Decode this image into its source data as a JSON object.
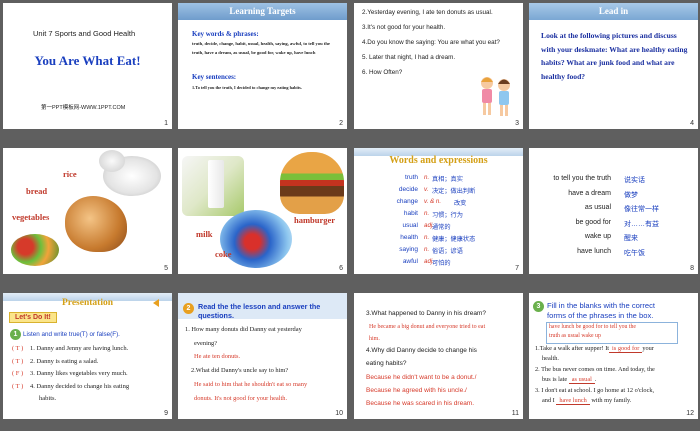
{
  "slides": [
    {
      "num": "1",
      "unit": "Unit 7 Sports and Good Health",
      "title": "You Are What Eat!",
      "footer": "第一PPT模板网-WWW.1PPT.COM"
    },
    {
      "num": "2",
      "header": "Learning Targets",
      "kw_title": "Key words & phrases:",
      "kw_body": "truth, decide, change, habit, usual, health, saying, awful, to tell you the truth, have a dream, as usual, be good for, wake up, have lunch",
      "ks_title": "Key sentences:",
      "ks_body": "1.To tell you the truth, I decided to change my eating habits."
    },
    {
      "num": "3",
      "lines": [
        "2.Yesterday evening, I ate ten donuts as usual.",
        "3.It's not good for your health.",
        "4.Do you know the saying: You are what you eat?",
        "5. Later that night, I had a dream.",
        "6. How Often?"
      ]
    },
    {
      "num": "4",
      "header": "Lead in",
      "body": "Look at the following pictures and discuss with your deskmate: What are healthy eating habits? What are junk food and what are healthy food?"
    },
    {
      "num": "5",
      "labels": {
        "rice": "rice",
        "bread": "bread",
        "vegetables": "vegetables"
      }
    },
    {
      "num": "6",
      "labels": {
        "milk": "milk",
        "coke": "coke",
        "hamburger": "hamburger"
      }
    },
    {
      "num": "7",
      "header": "Words and expressions",
      "words": [
        {
          "en": "truth",
          "pos": "n.",
          "cn": "真相；真实"
        },
        {
          "en": "decide",
          "pos": "v.",
          "cn": "决定；做出判断"
        },
        {
          "en": "change",
          "pos": "v. & n.",
          "cn": "改变"
        },
        {
          "en": "habit",
          "pos": "n.",
          "cn": "习惯；行为"
        },
        {
          "en": "usual",
          "pos": "adj.",
          "cn": "通常的"
        },
        {
          "en": "health",
          "pos": "n.",
          "cn": "健康；健康状态"
        },
        {
          "en": "saying",
          "pos": "n.",
          "cn": "俗语；谚语"
        },
        {
          "en": "awful",
          "pos": "adj.",
          "cn": "可怕的"
        }
      ]
    },
    {
      "num": "8",
      "phrases": [
        {
          "en": "to tell you the truth",
          "cn": "说实话"
        },
        {
          "en": "have a dream",
          "cn": "做梦"
        },
        {
          "en": "as usual",
          "cn": "像往常一样"
        },
        {
          "en": "be good for",
          "cn": "对……有益"
        },
        {
          "en": "wake up",
          "cn": "醒来"
        },
        {
          "en": "have lunch",
          "cn": "吃午饭"
        }
      ]
    },
    {
      "num": "9",
      "header": "Presentation",
      "button": "Let's Do It!",
      "badge": "1",
      "instr": "Listen and write true(T) or false(F).",
      "items": [
        {
          "ans": "( T )",
          "text": "1. Danny and Jenny are having lunch."
        },
        {
          "ans": "( T )",
          "text": "2. Danny is eating a salad."
        },
        {
          "ans": "( F )",
          "text": "3. Danny likes vegetables very much."
        },
        {
          "ans": "( T )",
          "text": "4. Danny decided to change his eating"
        },
        {
          "ans": "",
          "text": "habits."
        }
      ]
    },
    {
      "num": "10",
      "badge": "2",
      "title1": "Read the  the lesson and answer the",
      "title2": "questions.",
      "q1a": "1. How many donuts did Danny eat yesterday",
      "q1b": "evening?",
      "a1": "He ate ten donuts.",
      "q2": "2.What did Danny's uncle say to him?",
      "a2a": "He said to him that he shouldn't eat so many",
      "a2b": "donuts. It's not good for your health."
    },
    {
      "num": "11",
      "q3": "3.What happened to Danny in his dream?",
      "a3a": "He became a big donut and everyone tried to eat",
      "a3b": "him.",
      "q4a": "4.Why did Danny decide to change his",
      "q4b": "eating habits?",
      "a4a": "Because he didn't want to be a donut./",
      "a4b": "Because he agreed with his uncle./",
      "a4c": "Because he was scared in his dream."
    },
    {
      "num": "12",
      "badge": "3",
      "title1": "Fill in the blanks with the correct",
      "title2": "forms of the phrases in the box.",
      "box1": "have lunch    be good for    to tell you the",
      "box2": "truth     as usual      wake up",
      "s1a": "1.Take a walk after supper! It",
      "s1b": "is good for",
      "s1c": "your",
      "s1d": "health.",
      "s2a": "2. The bus never comes on time. And today, the",
      "s2b": "bus is late",
      "s2c": "as usual",
      "s3a": "3. I don't eat at school. I go home at 12 o'clock,",
      "s3b": "and I",
      "s3c": "have lunch",
      "s3d": "with my family."
    }
  ]
}
